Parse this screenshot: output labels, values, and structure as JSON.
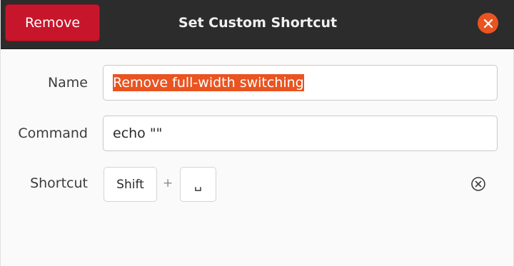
{
  "header": {
    "title": "Set Custom Shortcut",
    "remove_label": "Remove",
    "close_icon": "close-icon"
  },
  "form": {
    "name_label": "Name",
    "name_value": "Remove full-width switching",
    "command_label": "Command",
    "command_value": "echo \"\"",
    "shortcut_label": "Shortcut",
    "shortcut_keys": [
      "Shift",
      "␣"
    ],
    "shortcut_separator": "+",
    "clear_icon": "clear-shortcut-icon"
  },
  "colors": {
    "headerbar": "#2c2c2c",
    "destructive": "#c7162b",
    "accent": "#e95420"
  }
}
